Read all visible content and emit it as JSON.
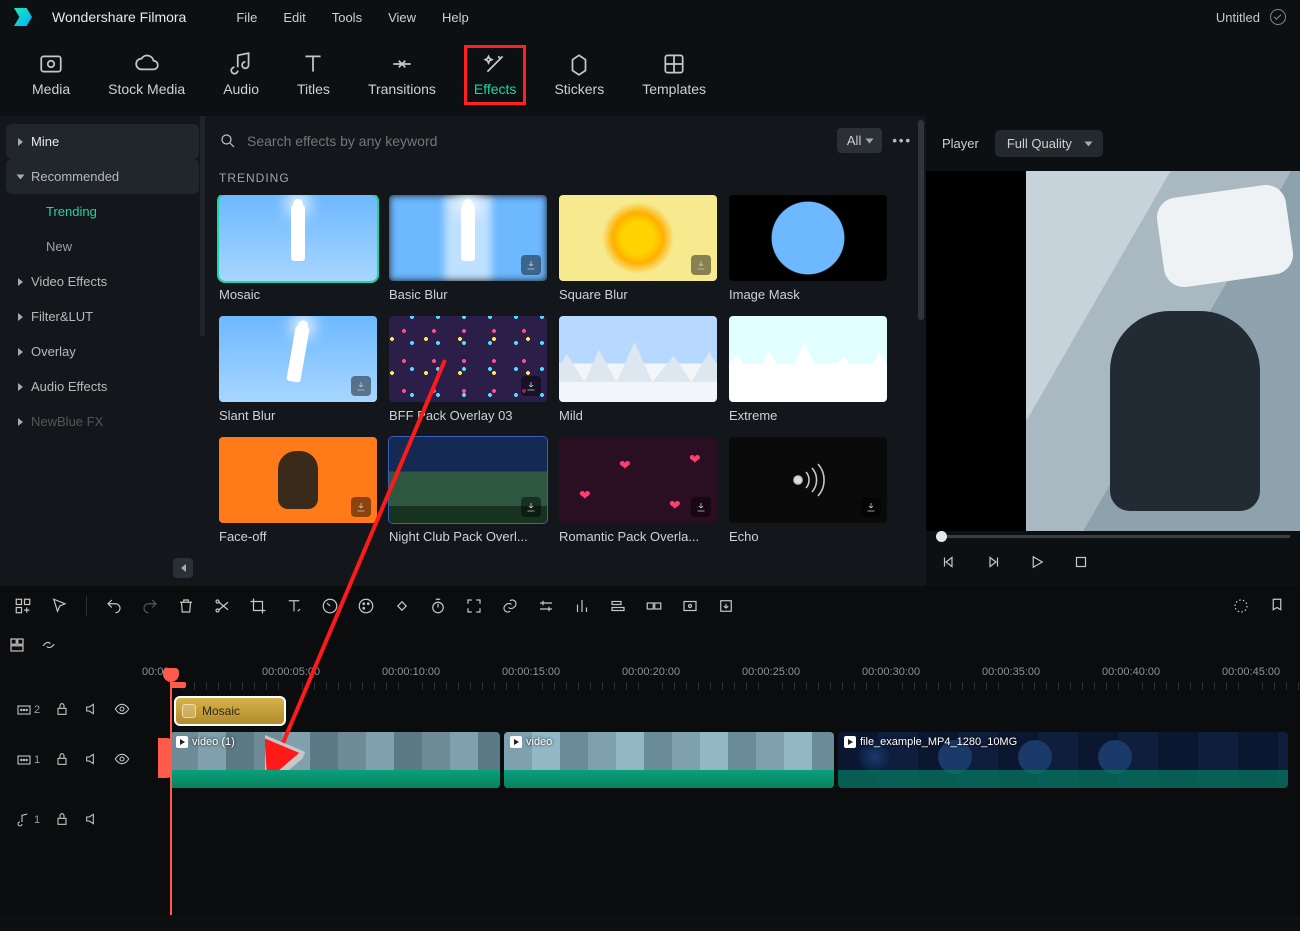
{
  "app": {
    "name": "Wondershare Filmora",
    "project_title": "Untitled"
  },
  "menu": {
    "file": "File",
    "edit": "Edit",
    "tools": "Tools",
    "view": "View",
    "help": "Help"
  },
  "tabs": {
    "media": "Media",
    "stock": "Stock Media",
    "audio": "Audio",
    "titles": "Titles",
    "transitions": "Transitions",
    "effects": "Effects",
    "stickers": "Stickers",
    "templates": "Templates"
  },
  "sidebar": {
    "mine": "Mine",
    "recommended": "Recommended",
    "trending": "Trending",
    "new": "New",
    "video_effects": "Video Effects",
    "filter_lut": "Filter&LUT",
    "overlay": "Overlay",
    "audio_effects": "Audio Effects",
    "newblue": "NewBlue FX"
  },
  "search": {
    "placeholder": "Search effects by any keyword",
    "filter_all": "All"
  },
  "gallery": {
    "section": "TRENDING",
    "items": [
      {
        "label": "Mosaic"
      },
      {
        "label": "Basic Blur"
      },
      {
        "label": "Square Blur"
      },
      {
        "label": "Image Mask"
      },
      {
        "label": "Slant Blur"
      },
      {
        "label": "BFF Pack Overlay 03"
      },
      {
        "label": "Mild"
      },
      {
        "label": "Extreme"
      },
      {
        "label": "Face-off"
      },
      {
        "label": "Night Club Pack Overl..."
      },
      {
        "label": "Romantic Pack Overla..."
      },
      {
        "label": "Echo"
      }
    ]
  },
  "player": {
    "label": "Player",
    "quality": "Full Quality"
  },
  "timeline": {
    "ticks": [
      "00:00",
      "00:00:05:00",
      "00:00:10:00",
      "00:00:15:00",
      "00:00:20:00",
      "00:00:25:00",
      "00:00:30:00",
      "00:00:35:00",
      "00:00:40:00",
      "00:00:45:00"
    ],
    "fx_clip": "Mosaic",
    "video_track1_clip1": "video (1)",
    "video_track1_clip2": "video",
    "video_track1_clip3": "file_example_MP4_1280_10MG",
    "track2_num": "2",
    "track1_num": "1",
    "audio_track_num": "1"
  }
}
